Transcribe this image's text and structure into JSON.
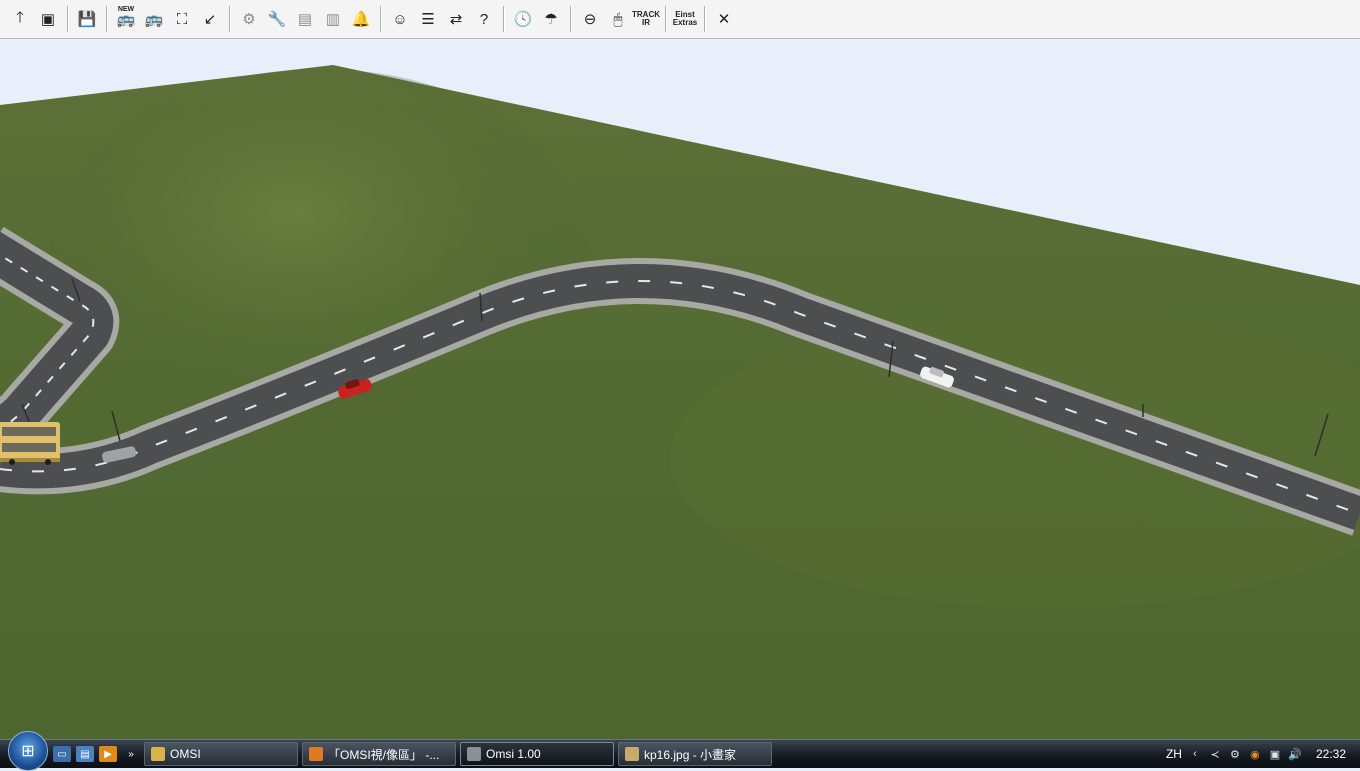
{
  "toolbar": {
    "buttons": [
      {
        "name": "up-arrow",
        "glyph": "🡑"
      },
      {
        "name": "map",
        "glyph": "▣"
      },
      {
        "name": "save",
        "glyph": "💾"
      },
      {
        "name": "new-bus",
        "glyph": "🚌",
        "label": "NEW"
      },
      {
        "name": "bus-select",
        "glyph": "🚌"
      },
      {
        "name": "frame",
        "glyph": "⛶"
      },
      {
        "name": "arrow-tool",
        "glyph": "↙"
      },
      {
        "name": "repair",
        "glyph": "⚙"
      },
      {
        "name": "wrench",
        "glyph": "🔧"
      },
      {
        "name": "ticket",
        "glyph": "▤"
      },
      {
        "name": "door",
        "glyph": "▥"
      },
      {
        "name": "bell",
        "glyph": "🔔"
      },
      {
        "name": "driver",
        "glyph": "☺"
      },
      {
        "name": "timetable",
        "glyph": "☰"
      },
      {
        "name": "exchange",
        "glyph": "⇄"
      },
      {
        "name": "help-arrow",
        "glyph": "?"
      },
      {
        "name": "clock",
        "glyph": "🕓"
      },
      {
        "name": "weather",
        "glyph": "☂"
      },
      {
        "name": "steering",
        "glyph": "⊖"
      },
      {
        "name": "mouse",
        "glyph": "🖱"
      },
      {
        "name": "trackir",
        "label": "TRACK IR"
      },
      {
        "name": "settings",
        "label": "Einst Extras"
      },
      {
        "name": "close",
        "glyph": "✕"
      }
    ]
  },
  "taskbar": {
    "tasks": [
      {
        "label": "OMSI",
        "color": "#d8b24a",
        "active": false
      },
      {
        "label": "「OMSI視/像區」 -...",
        "color": "#e07a22",
        "active": false
      },
      {
        "label": "Omsi 1.00",
        "color": "#8b8f96",
        "active": true
      },
      {
        "label": "kp16.jpg - 小畫家",
        "color": "#c9a86a",
        "active": false
      }
    ],
    "tray": {
      "lang": "ZH",
      "time": "22:32"
    }
  },
  "colors": {
    "sky": "#e9effa",
    "grass": "#536b33",
    "road": "#4c4e50",
    "curb": "#a8a8a4"
  }
}
